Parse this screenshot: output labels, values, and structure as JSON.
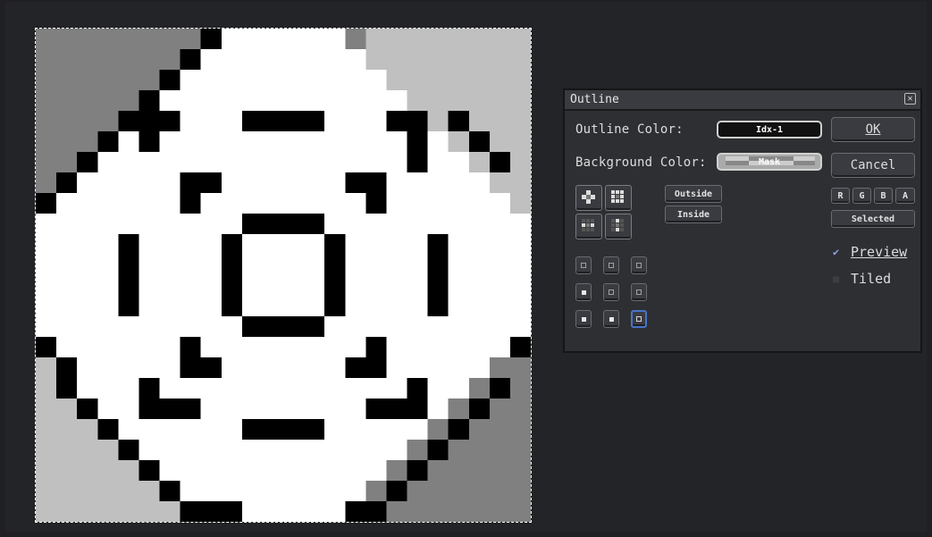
{
  "dialog": {
    "title": "Outline",
    "outline_color_label": "Outline Color:",
    "outline_color_value": "Idx-1",
    "background_color_label": "Background Color:",
    "background_color_value": "Mask",
    "ok_label": "OK",
    "cancel_label": "Cancel",
    "place_outside_label": "Outside",
    "place_inside_label": "Inside",
    "channels": [
      "R",
      "G",
      "B",
      "A"
    ],
    "selected_label": "Selected",
    "preview_label": "Preview",
    "preview_checked": true,
    "tiled_label": "Tiled",
    "tiled_checked": false,
    "matrix": [
      [
        0,
        0,
        0
      ],
      [
        1,
        0,
        0
      ],
      [
        1,
        1,
        2
      ]
    ]
  },
  "colors": {
    "app_bg": "#202024",
    "dialog_bg": "#2e2f33",
    "selected_accent": "#4a74c8",
    "canvas_white": "#ffffff",
    "canvas_black": "#000000",
    "canvas_dark_gray": "#808080",
    "canvas_light_gray": "#c0c0c0"
  }
}
